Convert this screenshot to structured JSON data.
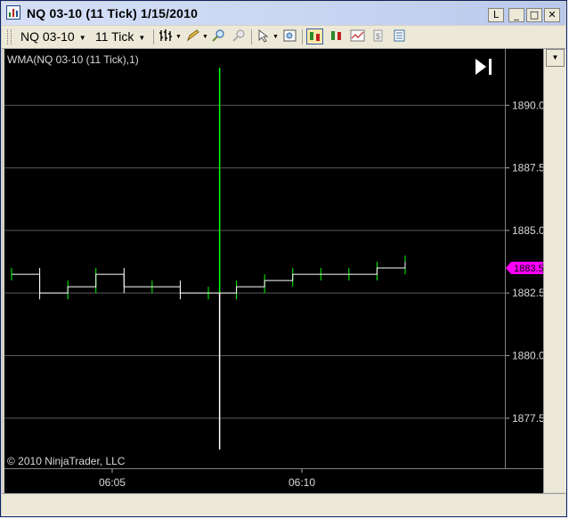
{
  "window": {
    "title": "NQ 03-10 (11 Tick)  1/15/2010"
  },
  "title_buttons": {
    "l": "L",
    "minimize": "_",
    "maximize": "□",
    "close": "✕"
  },
  "toolbar": {
    "instrument": "NQ 03-10",
    "interval": "11 Tick"
  },
  "chart": {
    "indicator_label": "WMA(NQ 03-10 (11 Tick),1)",
    "copyright": "© 2010 NinjaTrader, LLC",
    "price_ticks": [
      "1890.00",
      "1887.50",
      "1885.00",
      "1882.50",
      "1880.00",
      "1877.50"
    ],
    "price_tick_values": [
      1890.0,
      1887.5,
      1885.0,
      1882.5,
      1880.0,
      1877.5
    ],
    "current_price": {
      "label": "1883.50",
      "value": 1883.5
    },
    "time_ticks": [
      "06:05",
      "06:10"
    ],
    "colors": {
      "background": "#000000",
      "grid": "#5a5a5a",
      "up": "#00ff00",
      "down": "#ffffff",
      "price_marker": "#ff00ff",
      "wma_line": "#ffffff"
    }
  },
  "chart_data": {
    "type": "line",
    "title": "",
    "ylabel": "",
    "xlabel": "",
    "ylim": [
      1875.5,
      1892.25
    ],
    "x": [
      "06:04",
      "06:04",
      "06:05",
      "06:05",
      "06:06",
      "06:07",
      "06:08",
      "06:08",
      "06:09",
      "06:09",
      "06:10",
      "06:11",
      "06:12",
      "06:12",
      "06:13"
    ],
    "series": [
      {
        "values": [
          1883.25,
          1882.5,
          1882.75,
          1883.25,
          1882.75,
          1882.75,
          1882.5,
          1882.5,
          1882.75,
          1883.0,
          1883.25,
          1883.25,
          1883.25,
          1883.5,
          1883.75
        ]
      }
    ]
  }
}
